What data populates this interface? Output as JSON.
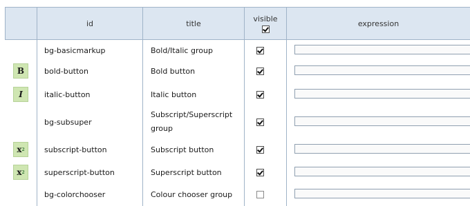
{
  "columns": {
    "id": "id",
    "title": "title",
    "visible": "visible",
    "expression": "expression"
  },
  "header_visible_checked": true,
  "rows": [
    {
      "id": "bg-basicmarkup",
      "title": "Bold/Italic group",
      "visible": true,
      "icon": null,
      "expression": ""
    },
    {
      "id": "bold-button",
      "title": "Bold button",
      "visible": true,
      "icon": "bold-icon",
      "icon_label": "B",
      "expression": ""
    },
    {
      "id": "italic-button",
      "title": "Italic button",
      "visible": true,
      "icon": "italic-icon",
      "icon_label": "I",
      "expression": ""
    },
    {
      "id": "bg-subsuper",
      "title": "Subscript/Superscript group",
      "title_line1": "Subscript/Superscript",
      "title_line2": "group",
      "visible": true,
      "icon": null,
      "expression": ""
    },
    {
      "id": "subscript-button",
      "title": "Subscript button",
      "visible": true,
      "icon": "subscript-icon",
      "icon_label": "x",
      "icon_sub": "2",
      "expression": ""
    },
    {
      "id": "superscript-button",
      "title": "Superscript button",
      "visible": true,
      "icon": "superscript-icon",
      "icon_label": "x",
      "icon_sup": "2",
      "expression": ""
    },
    {
      "id": "bg-colorchooser",
      "title": "Colour chooser group",
      "visible": false,
      "icon": null,
      "expression": ""
    }
  ]
}
